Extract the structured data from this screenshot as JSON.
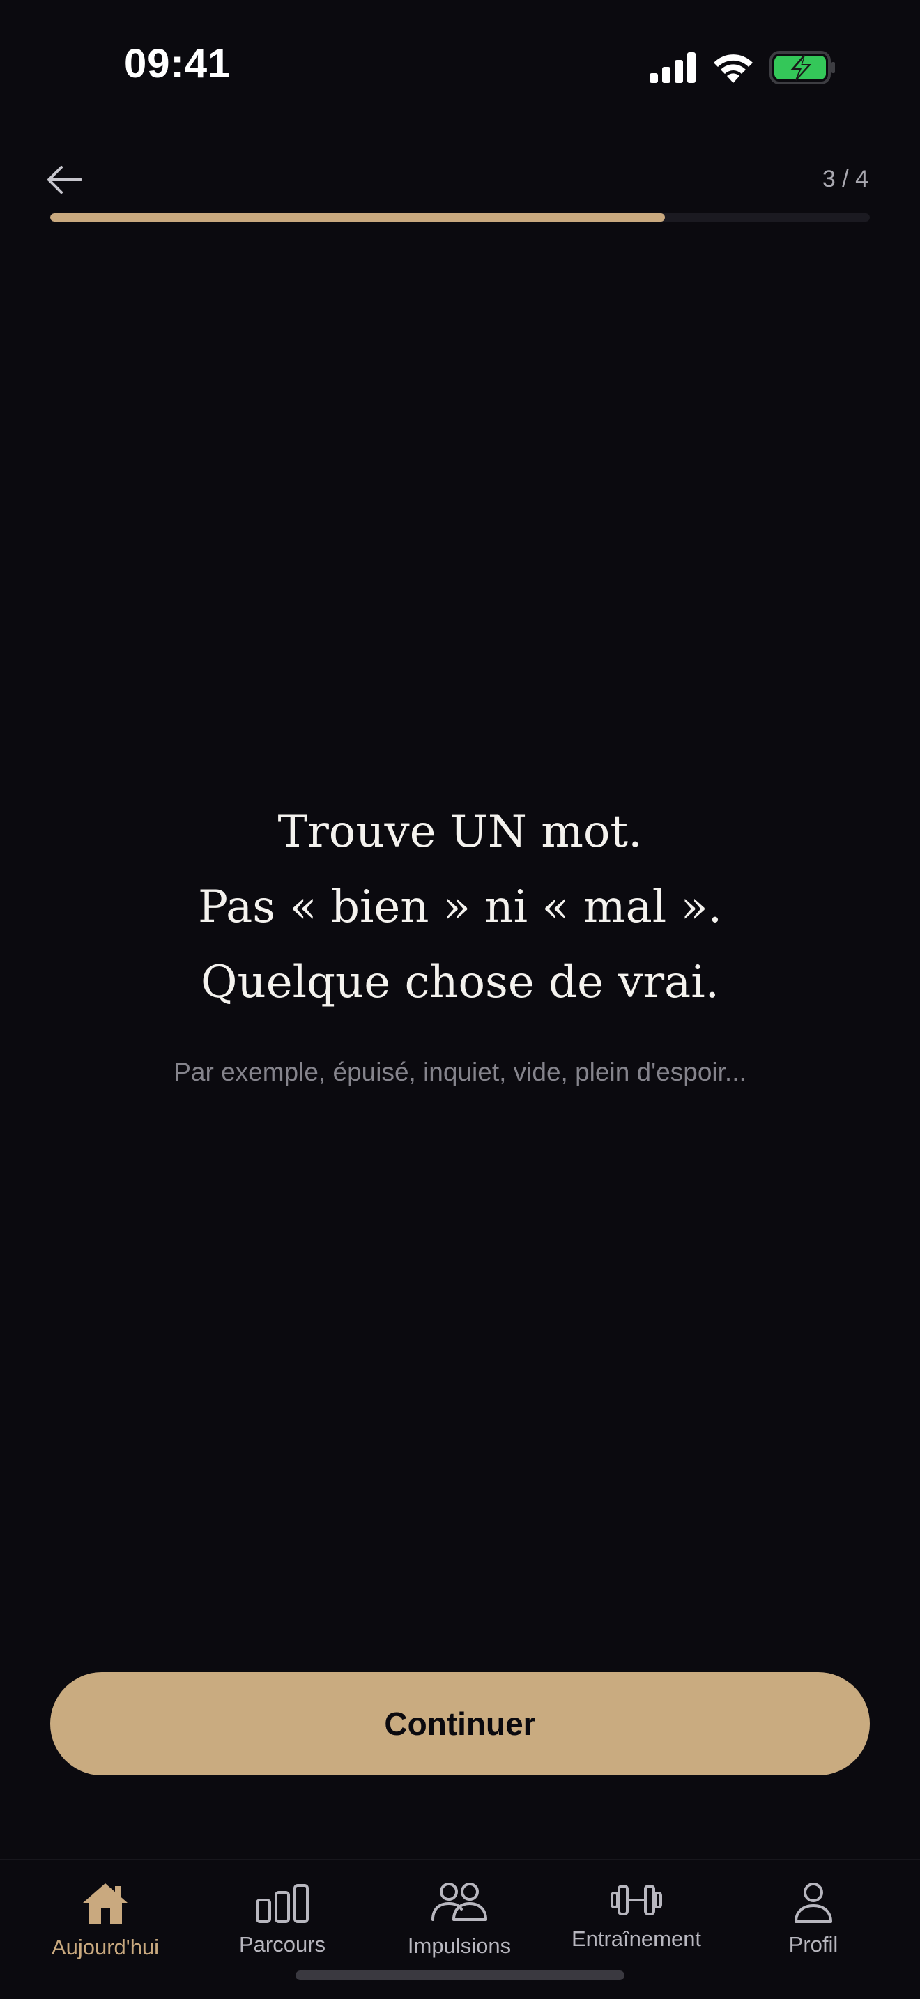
{
  "status_bar": {
    "time": "09:41"
  },
  "navigation": {
    "step_counter": "3 / 4",
    "progress": 0.75
  },
  "prompt": {
    "lines": [
      "Trouve UN mot.",
      "Pas « bien » ni « mal ».",
      "Quelque chose de vrai."
    ],
    "hint": "Par exemple, épuisé, inquiet, vide, plein d'espoir..."
  },
  "actions": {
    "continue_label": "Continuer"
  },
  "tab_bar": {
    "items": [
      {
        "label": "Aujourd'hui",
        "icon": "home-icon",
        "active": true
      },
      {
        "label": "Parcours",
        "icon": "bar-chart-icon",
        "active": false
      },
      {
        "label": "Impulsions",
        "icon": "people-icon",
        "active": false
      },
      {
        "label": "Entraînement",
        "icon": "dumbbell-icon",
        "active": false
      },
      {
        "label": "Profil",
        "icon": "person-icon",
        "active": false
      }
    ]
  },
  "colors": {
    "background": "#0b0a0f",
    "accent": "#c9a97f",
    "battery": "#34c759"
  }
}
